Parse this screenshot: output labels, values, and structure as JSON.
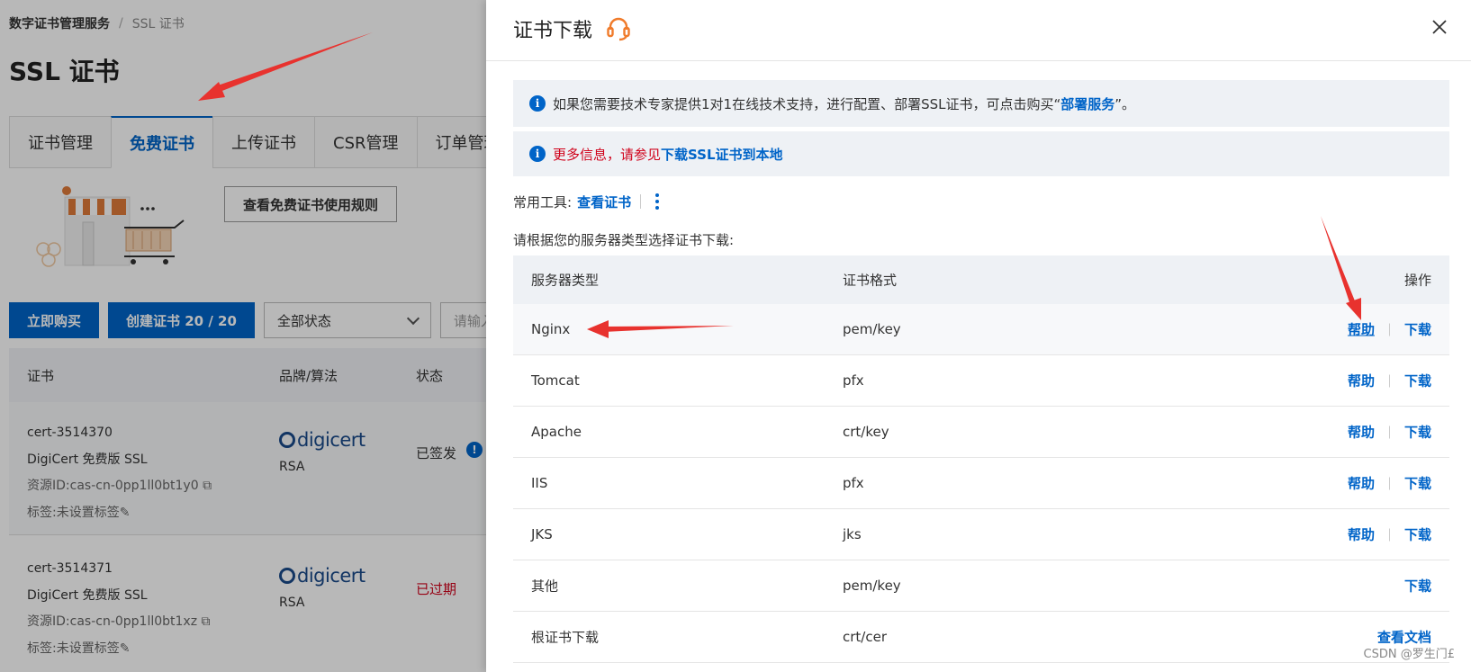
{
  "breadcrumb": {
    "home": "数字证书管理服务",
    "sep": "/",
    "current": "SSL 证书"
  },
  "page_title": "SSL 证书",
  "tabs": [
    {
      "label": "证书管理"
    },
    {
      "label": "免费证书"
    },
    {
      "label": "上传证书"
    },
    {
      "label": "CSR管理"
    },
    {
      "label": "订单管理"
    }
  ],
  "rules_button": "查看免费证书使用规则",
  "actions": {
    "buy": "立即购买",
    "create": "创建证书 20 / 20",
    "status_select": "全部状态",
    "search_placeholder": "请输入"
  },
  "list_headers": {
    "cert": "证书",
    "brand": "品牌/算法",
    "status": "状态"
  },
  "certs": [
    {
      "id": "cert-3514370",
      "name": "DigiCert 免费版 SSL",
      "resource": "资源ID:cas-cn-0pp1ll0bt1y0",
      "tag": "标签:未设置标签",
      "brand": "digicert",
      "algo": "RSA",
      "status": "已签发",
      "status_color": "#333333"
    },
    {
      "id": "cert-3514371",
      "name": "DigiCert 免费版 SSL",
      "resource": "资源ID:cas-cn-0pp1ll0bt1xz",
      "tag": "标签:未设置标签",
      "brand": "digicert",
      "algo": "RSA",
      "status": "已过期",
      "status_color": "#d0021b"
    }
  ],
  "drawer": {
    "title": "证书下载",
    "notice1": {
      "text": "如果您需要技术专家提供1对1在线技术支持，进行配置、部署SSL证书，可点击购买“",
      "link": "部署服务",
      "suffix": "”。"
    },
    "notice2": {
      "red": "更多信息，请参见",
      "link": "下载SSL证书到本地"
    },
    "tools_label": "常用工具:",
    "tools_link": "查看证书",
    "select_hint": "请根据您的服务器类型选择证书下载:",
    "table_headers": {
      "type": "服务器类型",
      "format": "证书格式",
      "ops": "操作"
    },
    "rows": [
      {
        "type": "Nginx",
        "format": "pem/key",
        "help": "帮助",
        "download": "下载"
      },
      {
        "type": "Tomcat",
        "format": "pfx",
        "help": "帮助",
        "download": "下载"
      },
      {
        "type": "Apache",
        "format": "crt/key",
        "help": "帮助",
        "download": "下载"
      },
      {
        "type": "IIS",
        "format": "pfx",
        "help": "帮助",
        "download": "下载"
      },
      {
        "type": "JKS",
        "format": "jks",
        "help": "帮助",
        "download": "下载"
      },
      {
        "type": "其他",
        "format": "pem/key",
        "download": "下载"
      },
      {
        "type": "根证书下载",
        "format": "crt/cer",
        "doc": "查看文档"
      }
    ]
  },
  "watermark": "CSDN @罗生门£",
  "colors": {
    "accent": "#0064c8",
    "annotation_arrow": "#e8322e",
    "headset": "#f07b2b"
  }
}
